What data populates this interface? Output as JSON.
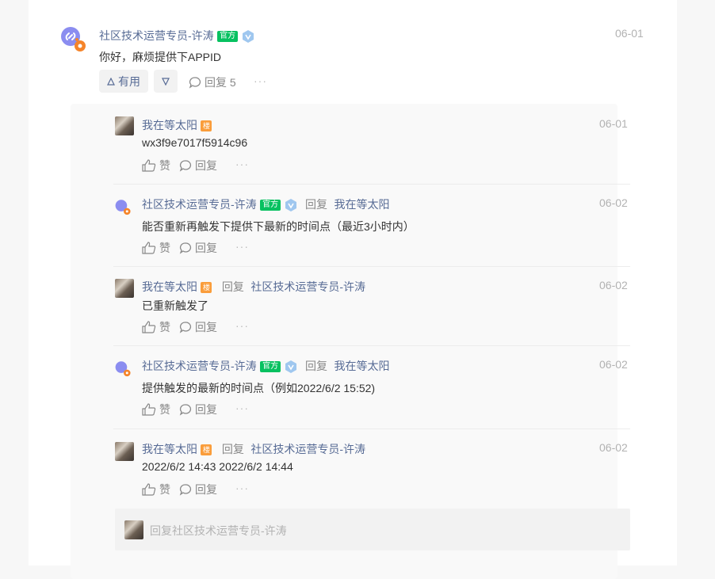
{
  "post": {
    "author": "社区技术运营专员-许涛",
    "official_tag": "官方",
    "date": "06-01",
    "text": "你好，麻烦提供下APPID",
    "useful_label": "有用",
    "reply_label": "回复 5",
    "more": "···"
  },
  "replies": [
    {
      "author": "我在等太阳",
      "tag": "楼",
      "reply_word": "",
      "target": "",
      "date": "06-01",
      "text": "wx3f9e7017f5914c96",
      "like": "赞",
      "reply": "回复",
      "more": "···"
    },
    {
      "author": "社区技术运营专员-许涛",
      "tag": "官方",
      "reply_word": "回复",
      "target": "我在等太阳",
      "date": "06-02",
      "text": "能否重新再触发下提供下最新的时间点（最近3小时内）",
      "like": "赞",
      "reply": "回复",
      "more": "···"
    },
    {
      "author": "我在等太阳",
      "tag": "楼",
      "reply_word": "回复",
      "target": "社区技术运营专员-许涛",
      "date": "06-02",
      "text": "已重新触发了",
      "like": "赞",
      "reply": "回复",
      "more": "···"
    },
    {
      "author": "社区技术运营专员-许涛",
      "tag": "官方",
      "reply_word": "回复",
      "target": "我在等太阳",
      "date": "06-02",
      "text": "提供触发的最新的时间点（例如2022/6/2  15:52)",
      "like": "赞",
      "reply": "回复",
      "more": "···"
    },
    {
      "author": "我在等太阳",
      "tag": "楼",
      "reply_word": "回复",
      "target": "社区技术运营专员-许涛",
      "date": "06-02",
      "text": "2022/6/2 14:43 2022/6/2 14:44",
      "like": "赞",
      "reply": "回复",
      "more": "···"
    }
  ],
  "composer": {
    "placeholder": "回复社区技术运营专员-许涛"
  }
}
